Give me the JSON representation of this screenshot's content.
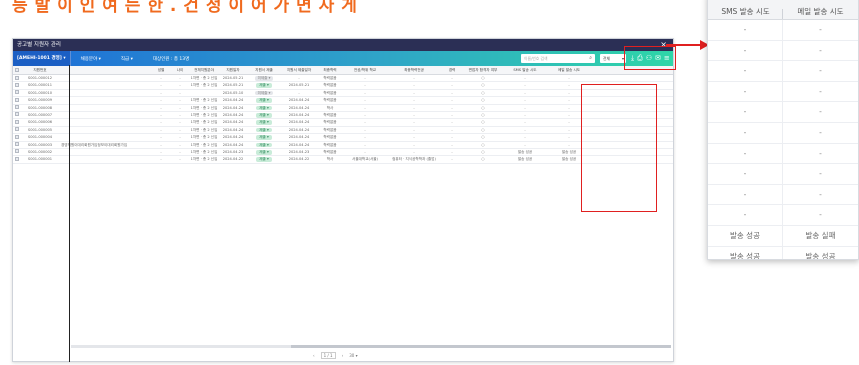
{
  "headline": "등 발 이 인 여 는 한 . 건 정 이 어 가 면 사 게",
  "window": {
    "title": "공고별 지원자 관리",
    "close_icon": "close-icon"
  },
  "toolbar": {
    "company": "[AMEHI-1001 경영] ▾",
    "items": [
      "채용분야 ▾",
      "직급 ▾",
      "대상인원 : 총 13명"
    ],
    "search_placeholder": "이름/번호 검색",
    "select_value": "전체",
    "icons": [
      "download-icon",
      "print-icon",
      "user-add-icon",
      "mail-icon",
      "menu-icon"
    ]
  },
  "columns": [
    "",
    "지원번호",
    "",
    "성별",
    "나이",
    "전체지원분야",
    "지원일자",
    "지원서 제출",
    "지원서 제출일자",
    "최종학력",
    "전공/학위 학교",
    "최종학력전공",
    "경력",
    "면접자 합격자 여부",
    "SMS 발송 시도",
    "메일 발송 시도"
  ],
  "rows": [
    {
      "id": "S001-000012",
      "name": "",
      "gender": "-",
      "age": "-",
      "field": "1차면 · 총 2 신입",
      "date": "2024.05.21",
      "submit": "미제출 ▾",
      "submit_gray": true,
      "submit_date": "-",
      "edu": "학력없음",
      "school": "-",
      "major": "-",
      "career": "-",
      "pass": "○",
      "sms": "-",
      "mail": "-"
    },
    {
      "id": "S001-000011",
      "name": "",
      "gender": "-",
      "age": "-",
      "field": "1차면 · 총 2 신입",
      "date": "2024.05.21",
      "submit": "제출 ▾",
      "submit_gray": false,
      "submit_date": "2024.05.21",
      "edu": "학력없음",
      "school": "-",
      "major": "-",
      "career": "-",
      "pass": "○",
      "sms": "-",
      "mail": "-"
    },
    {
      "id": "S001-000010",
      "name": "",
      "gender": "-",
      "age": "-",
      "field": "",
      "date": "2024.05.10",
      "submit": "미제출 ▾",
      "submit_gray": true,
      "submit_date": "-",
      "edu": "학력없음",
      "school": "-",
      "major": "-",
      "career": "-",
      "pass": "○",
      "sms": "-",
      "mail": "-"
    },
    {
      "id": "S001-000009",
      "name": "",
      "gender": "-",
      "age": "-",
      "field": "1차면 · 총 2 신입",
      "date": "2024.04.24",
      "submit": "제출 ▾",
      "submit_gray": false,
      "submit_date": "2024.04.24",
      "edu": "학력없음",
      "school": "-",
      "major": "-",
      "career": "-",
      "pass": "○",
      "sms": "-",
      "mail": "-"
    },
    {
      "id": "S001-000008",
      "name": "",
      "gender": "-",
      "age": "-",
      "field": "1차면 · 총 2 신입",
      "date": "2024.04.24",
      "submit": "제출 ▾",
      "submit_gray": false,
      "submit_date": "2024.04.24",
      "edu": "학사",
      "school": "-",
      "major": "-",
      "career": "-",
      "pass": "○",
      "sms": "-",
      "mail": "-"
    },
    {
      "id": "S001-000007",
      "name": "",
      "gender": "-",
      "age": "-",
      "field": "1차면 · 총 2 신입",
      "date": "2024.04.24",
      "submit": "제출 ▾",
      "submit_gray": false,
      "submit_date": "2024.04.24",
      "edu": "학력없음",
      "school": "-",
      "major": "-",
      "career": "-",
      "pass": "○",
      "sms": "-",
      "mail": "-"
    },
    {
      "id": "S001-000006",
      "name": "",
      "gender": "-",
      "age": "-",
      "field": "1차면 · 총 2 신입",
      "date": "2024.04.24",
      "submit": "제출 ▾",
      "submit_gray": false,
      "submit_date": "2024.04.24",
      "edu": "학력없음",
      "school": "-",
      "major": "-",
      "career": "-",
      "pass": "○",
      "sms": "-",
      "mail": "-"
    },
    {
      "id": "S001-000005",
      "name": "",
      "gender": "-",
      "age": "-",
      "field": "1차면 · 총 2 신입",
      "date": "2024.04.24",
      "submit": "제출 ▾",
      "submit_gray": false,
      "submit_date": "2024.04.24",
      "edu": "학력없음",
      "school": "-",
      "major": "-",
      "career": "-",
      "pass": "○",
      "sms": "-",
      "mail": "-"
    },
    {
      "id": "S001-000004",
      "name": "",
      "gender": "-",
      "age": "-",
      "field": "1차면 · 총 2 신입",
      "date": "2024.04.24",
      "submit": "제출 ▾",
      "submit_gray": false,
      "submit_date": "2024.04.24",
      "edu": "학력없음",
      "school": "-",
      "major": "-",
      "career": "-",
      "pass": "○",
      "sms": "-",
      "mail": "-"
    },
    {
      "id": "S001-000003",
      "name": "경영지원이대리회원가입정보이대리회원가입",
      "gender": "-",
      "age": "-",
      "field": "1차면 · 총 2 신입",
      "date": "2024.04.24",
      "submit": "제출 ▾",
      "submit_gray": false,
      "submit_date": "2024.04.24",
      "edu": "학력없음",
      "school": "-",
      "major": "-",
      "career": "-",
      "pass": "○",
      "sms": "-",
      "mail": "-"
    },
    {
      "id": "S001-000002",
      "name": "",
      "gender": "-",
      "age": "-",
      "field": "1차면 · 총 2 신입",
      "date": "2024.04.23",
      "submit": "제출 ▾",
      "submit_gray": false,
      "submit_date": "2024.04.23",
      "edu": "학력없음",
      "school": "-",
      "major": "-",
      "career": "-",
      "pass": "○",
      "sms": "발송 성공",
      "mail": "발송 성공"
    },
    {
      "id": "S001-000001",
      "name": "",
      "gender": "-",
      "age": "-",
      "field": "1차면 · 총 2 신입",
      "date": "2024.04.22",
      "submit": "제출 ▾",
      "submit_gray": false,
      "submit_date": "2024.04.22",
      "edu": "학사",
      "school": "서울대학교(서울)",
      "major": "컴퓨터 · 지식공학학과 (졸업)",
      "career": "-",
      "pass": "○",
      "sms": "발송 성공",
      "mail": "발송 성공"
    }
  ],
  "pager": {
    "prev": "‹",
    "page": "1 / 1",
    "next": "›",
    "size": "30 ▾"
  },
  "zoom": {
    "col_sms": "SMS 발송 시도",
    "col_mail": "메일 발송 시도",
    "rows": [
      [
        "-",
        "-"
      ],
      [
        "-",
        "-"
      ],
      [
        "-",
        "-"
      ],
      [
        "-",
        "-"
      ],
      [
        "-",
        "-"
      ],
      [
        "-",
        "-"
      ],
      [
        "-",
        "-"
      ],
      [
        "-",
        "-"
      ],
      [
        "-",
        "-"
      ],
      [
        "-",
        "-"
      ],
      [
        "발송 성공",
        "발송 실패"
      ],
      [
        "발송 성공",
        "발송 성공"
      ]
    ]
  },
  "highlight_color": "#e02020"
}
